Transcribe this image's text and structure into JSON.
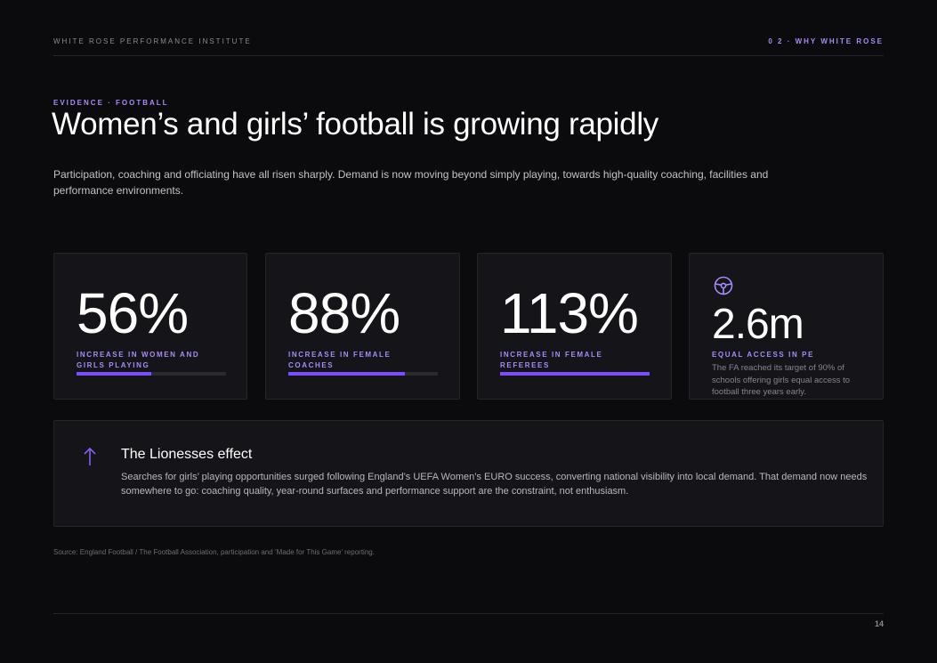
{
  "header": {
    "brand": "WHITE ROSE PERFORMANCE INSTITUTE",
    "section": "0 2 · WHY WHITE ROSE"
  },
  "eyebrow": "EVIDENCE · FOOTBALL",
  "title": "Women’s and girls’ football is growing rapidly",
  "intro": "Participation, coaching and officiating have all risen sharply. Demand is now moving beyond simply playing, towards high-quality coaching, facilities and performance environments.",
  "stats": [
    {
      "value": "56%",
      "label": "INCREASE IN WOMEN AND GIRLS PLAYING",
      "progress": 0.5
    },
    {
      "value": "88%",
      "label": "INCREASE IN FEMALE COACHES",
      "progress": 0.78
    },
    {
      "value": "113%",
      "label": "INCREASE IN FEMALE REFEREES",
      "progress": 1.0
    },
    {
      "value": "2.6m",
      "label": "EQUAL ACCESS IN PE",
      "note": "The FA reached its target of 90% of schools offering girls equal access to football three years early.",
      "icon": "steering-wheel-icon"
    }
  ],
  "panel": {
    "icon": "arrow-up-icon",
    "title": "The Lionesses effect",
    "body": "Searches for girls’ playing opportunities surged following England’s UEFA Women’s EURO success, converting national visibility into local demand. That demand now needs somewhere to go: coaching quality, year-round surfaces and performance support are the constraint, not enthusiasm."
  },
  "source": "Source: England Football / The Football Association, participation and ‘Made for This Game’ reporting.",
  "page_number": "14",
  "colors": {
    "accent": "#a78bfa",
    "bar": "#7c4dff",
    "background": "#0b0b0d",
    "card": "#141419"
  }
}
